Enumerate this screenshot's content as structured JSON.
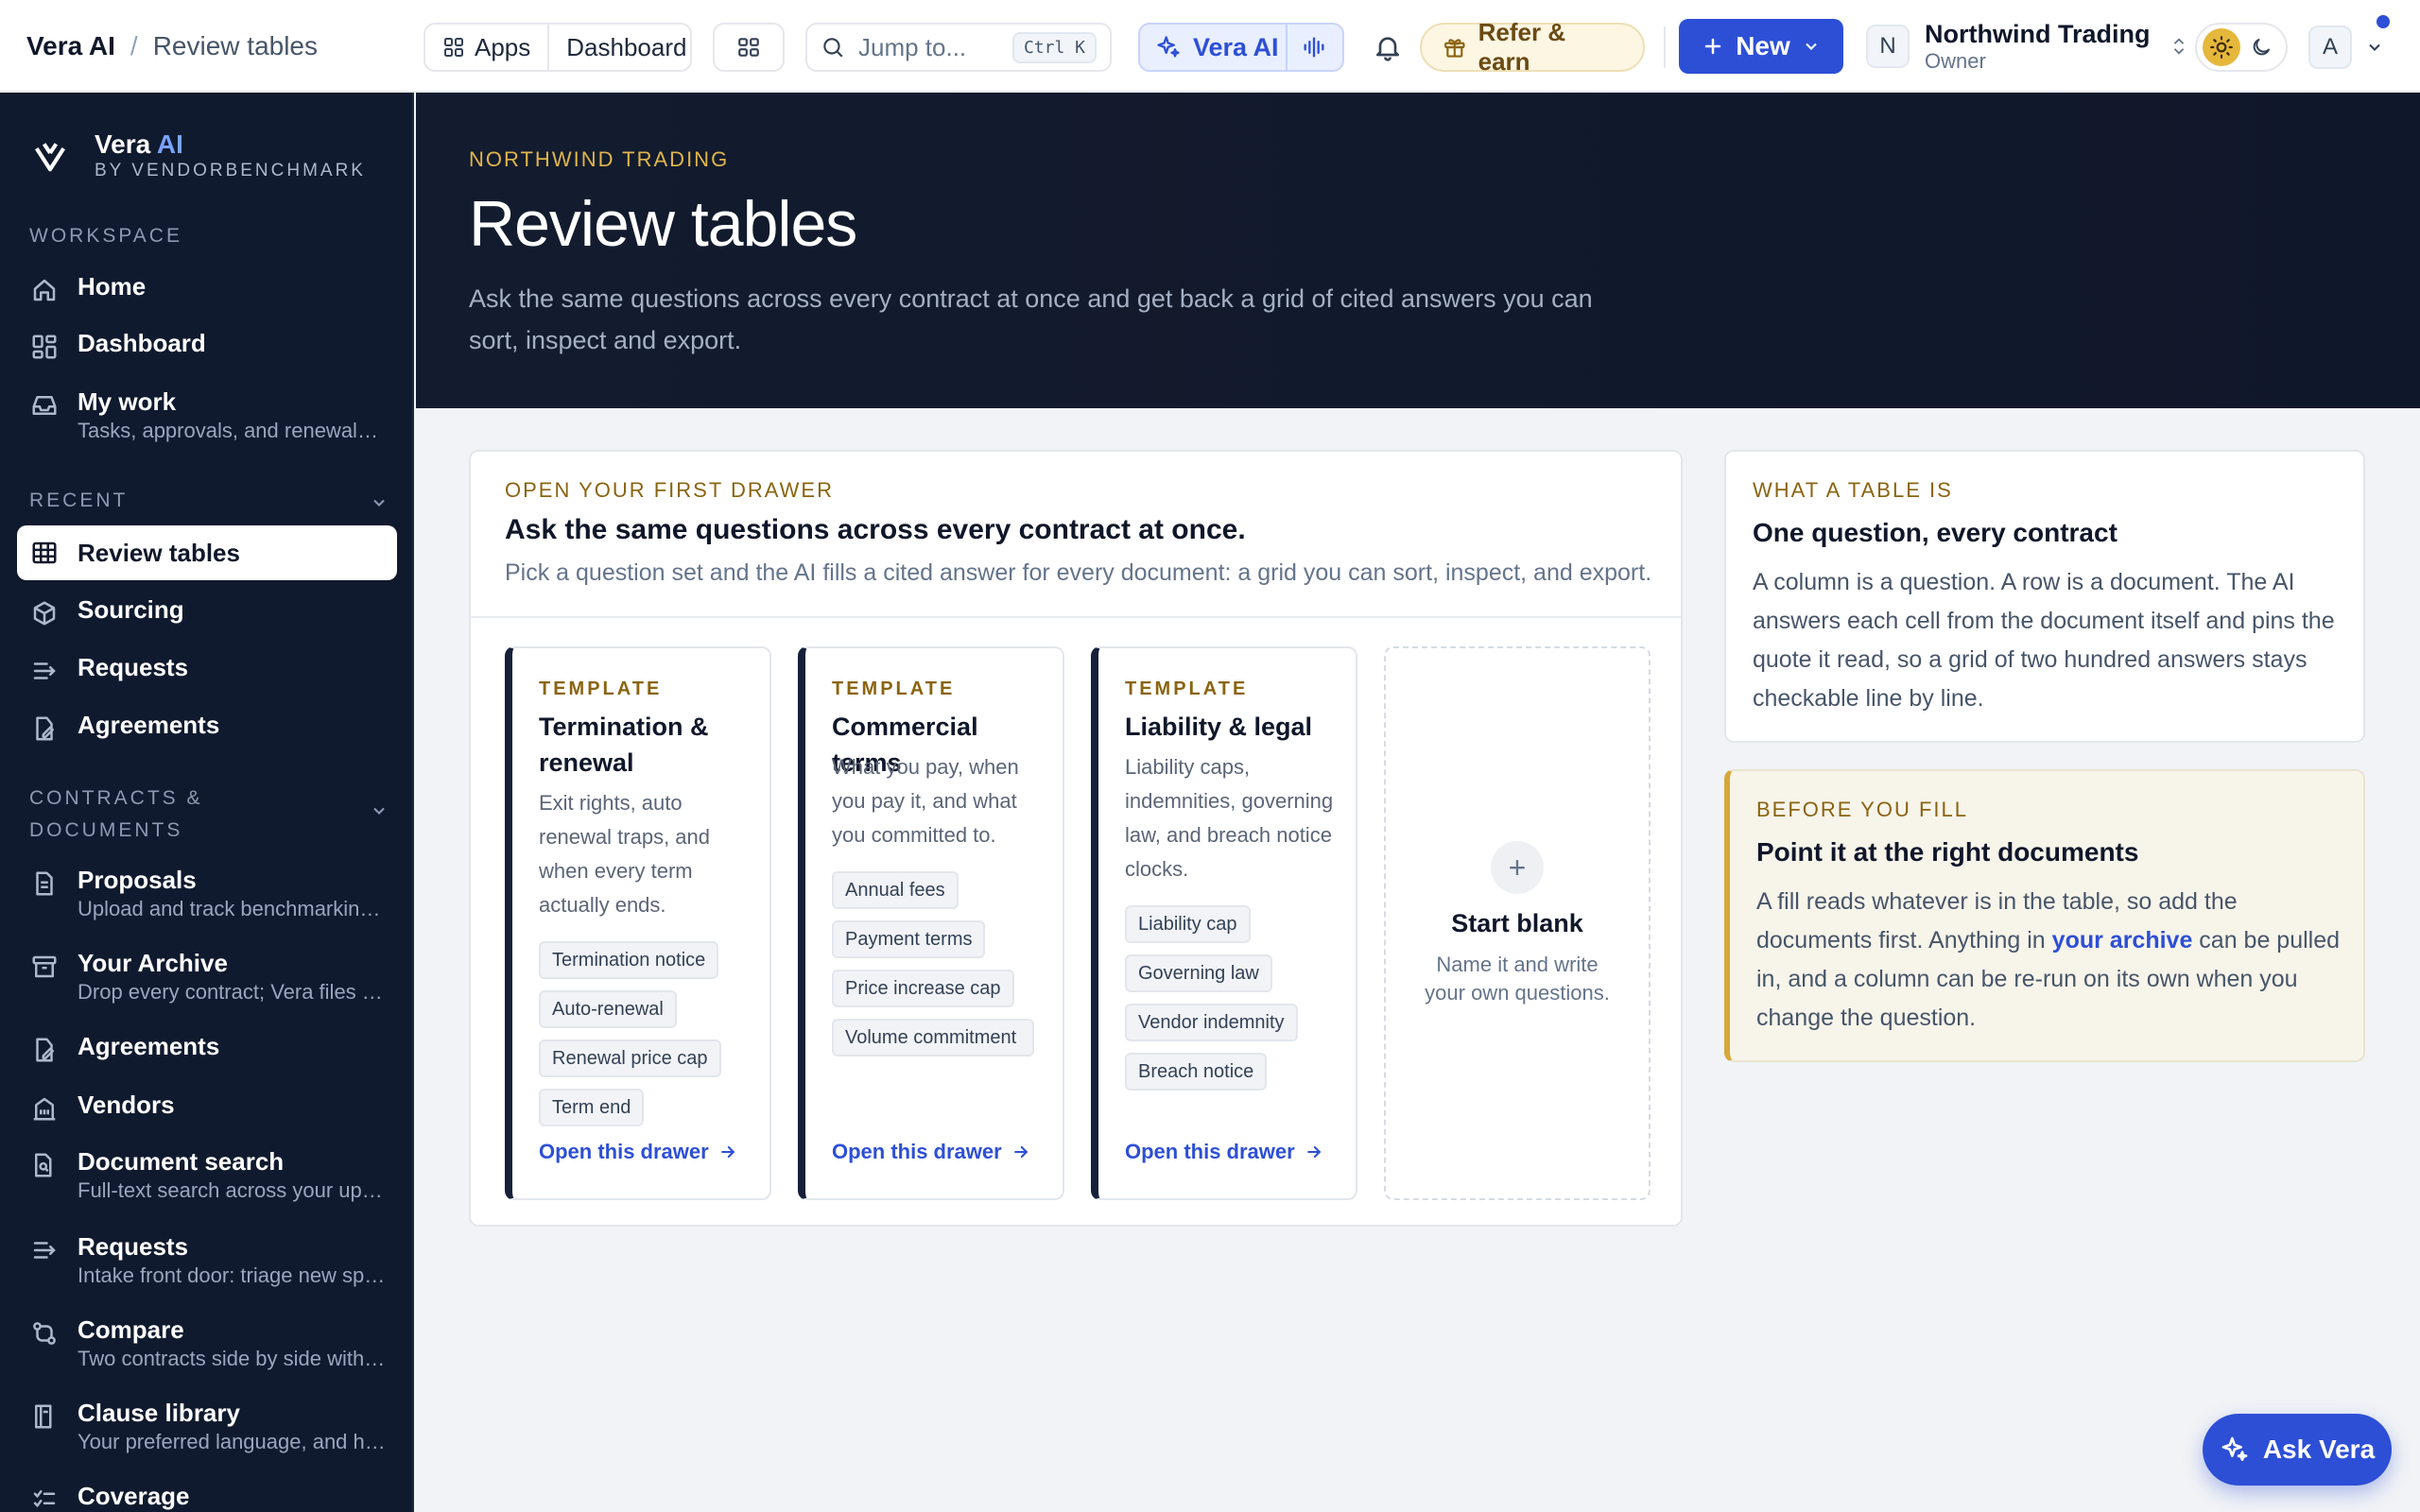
{
  "breadcrumb": {
    "app": "Vera AI",
    "separator": "/",
    "page": "Review tables"
  },
  "topbar": {
    "apps_label": "Apps",
    "dashboard_label": "Dashboard",
    "search_placeholder": "Jump to...",
    "search_shortcut": "Ctrl K",
    "vera_label": "Vera AI",
    "refer_label": "Refer & earn",
    "new_label": "New",
    "org_initial": "N",
    "org_name": "Northwind Trading",
    "org_role": "Owner",
    "user_initial": "A"
  },
  "sidebar": {
    "brand_name": "Vera",
    "brand_ai": "AI",
    "brand_sub": "BY VENDORBENCHMARK",
    "workspace_label": "WORKSPACE",
    "workspace_items": [
      {
        "label": "Home"
      },
      {
        "label": "Dashboard"
      },
      {
        "label": "My work",
        "sub": "Tasks, approvals, and renewals waiting on you"
      }
    ],
    "recent_label": "RECENT",
    "recent_items": [
      {
        "label": "Review tables"
      },
      {
        "label": "Sourcing"
      },
      {
        "label": "Requests"
      },
      {
        "label": "Agreements"
      }
    ],
    "contracts_label_1": "CONTRACTS &",
    "contracts_label_2": "DOCUMENTS",
    "contracts_items": [
      {
        "label": "Proposals",
        "sub": "Upload and track benchmarking proposals"
      },
      {
        "label": "Your Archive",
        "sub": "Drop every contract; Vera files them for you"
      },
      {
        "label": "Agreements"
      },
      {
        "label": "Vendors"
      },
      {
        "label": "Document search",
        "sub": "Full-text search across your uploaded documents"
      },
      {
        "label": "Requests",
        "sub": "Intake front door: triage new spend requests"
      },
      {
        "label": "Compare",
        "sub": "Two contracts side by side with differences"
      },
      {
        "label": "Clause library",
        "sub": "Your preferred language, and how to negotiate it"
      },
      {
        "label": "Coverage"
      }
    ]
  },
  "hero": {
    "eyebrow": "NORTHWIND TRADING",
    "title": "Review tables",
    "description": "Ask the same questions across every contract at once and get back a grid of cited answers you can sort, inspect and export."
  },
  "main_card": {
    "eyebrow": "OPEN YOUR FIRST DRAWER",
    "title": "Ask the same questions across every contract at once.",
    "subtitle": "Pick a question set and the AI fills a cited answer for every document: a grid you can sort, inspect, and export.",
    "templates": [
      {
        "eyebrow": "TEMPLATE",
        "name": "Termination & renewal",
        "description": "Exit rights, auto renewal traps, and when every term actually ends.",
        "tags": [
          "Termination notice",
          "Auto-renewal",
          "Renewal price cap",
          "Term end"
        ],
        "link": "Open this drawer"
      },
      {
        "eyebrow": "TEMPLATE",
        "name": "Commercial terms",
        "description": "What you pay, when you pay it, and what you committed to.",
        "tags": [
          "Annual fees",
          "Payment terms",
          "Price increase cap",
          "Volume commitment"
        ],
        "link": "Open this drawer"
      },
      {
        "eyebrow": "TEMPLATE",
        "name": "Liability & legal",
        "description": "Liability caps, indemnities, governing law, and breach notice clocks.",
        "tags": [
          "Liability cap",
          "Governing law",
          "Vendor indemnity",
          "Breach notice"
        ],
        "link": "Open this drawer"
      }
    ],
    "blank": {
      "plus": "+",
      "title": "Start blank",
      "description": "Name it and write your own questions."
    }
  },
  "what_card": {
    "eyebrow": "WHAT A TABLE IS",
    "title": "One question, every contract",
    "body": "A column is a question. A row is a document. The AI answers each cell from the document itself and pins the quote it read, so a grid of two hundred answers stays checkable line by line."
  },
  "before_card": {
    "eyebrow": "BEFORE YOU FILL",
    "title": "Point it at the right documents",
    "body_pre": "A fill reads whatever is in the table, so add the documents first. Anything in ",
    "body_link": "your archive",
    "body_post": " can be pulled in, and a column can be re-run on its own when you change the question."
  },
  "fab": {
    "label": "Ask Vera"
  },
  "colors": {
    "accent": "#2d4fd6",
    "sidebar_bg": "#101a2e",
    "gold": "#8a6410",
    "hero_eyebrow": "#e0b54c"
  },
  "icons": [
    "grid-icon",
    "apps-grid-icon",
    "search-icon",
    "sparkle-icon",
    "waveform-icon",
    "bell-icon",
    "gift-icon",
    "plus-icon",
    "chevron-down-icon",
    "sort-icon",
    "sun-icon",
    "moon-icon",
    "home-icon",
    "dashboard-icon",
    "inbox-icon",
    "table-icon",
    "cube-icon",
    "requests-icon",
    "agreement-icon",
    "document-icon",
    "archive-icon",
    "building-icon",
    "document-search-icon",
    "compare-icon",
    "book-icon",
    "coverage-icon",
    "arrow-right-icon"
  ]
}
